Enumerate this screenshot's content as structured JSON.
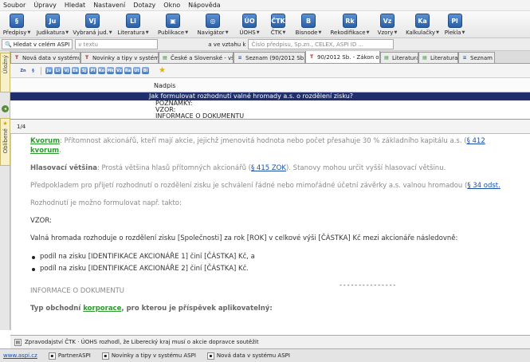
{
  "menu": [
    "Soubor",
    "Úpravy",
    "Hledat",
    "Nastavení",
    "Dotazy",
    "Okno",
    "Nápověda"
  ],
  "toolbar": [
    {
      "label": "Předpisy",
      "glyph": "§",
      "w": 42
    },
    {
      "label": "Judikatura",
      "glyph": "Ju",
      "w": 48
    },
    {
      "label": "Vybraná jud.",
      "glyph": "Vj",
      "w": 52
    },
    {
      "label": "Literatura",
      "glyph": "Li",
      "w": 50
    },
    {
      "label": "Publikace",
      "glyph": "▣",
      "w": 50
    },
    {
      "label": "Navigátor",
      "glyph": "◎",
      "w": 50
    },
    {
      "label": "ÚOHS",
      "glyph": "ÚO",
      "w": 42
    },
    {
      "label": "ČTK",
      "glyph": "ČTK",
      "w": 30
    },
    {
      "label": "Bisnode",
      "glyph": "B",
      "w": 46
    },
    {
      "label": "Rekodifikace",
      "glyph": "Rk",
      "w": 58
    },
    {
      "label": "Vzory",
      "glyph": "Vz",
      "w": 36
    },
    {
      "label": "Kalkulačky",
      "glyph": "Ka",
      "w": 52
    },
    {
      "label": "Plekla",
      "glyph": "Pl",
      "w": 29
    }
  ],
  "search": {
    "label1": "Hledat v celém ASPI",
    "placeholder1": "v textu",
    "label2": "a ve vztahu k",
    "placeholder2": "Číslo předpisu, Sp.zn., CELEX, ASPI ID ..."
  },
  "left_tabs": {
    "top": "Úložný",
    "bottom": "Oblíbené"
  },
  "doc_tabs": [
    {
      "label": "Nová data v systému A...",
      "icon": "T",
      "color": "#c02020",
      "w": 88,
      "active": false
    },
    {
      "label": "Novinky a tipy v systém...",
      "icon": "T",
      "color": "#c02020",
      "w": 98,
      "active": false
    },
    {
      "label": "České a Slovenské - vše...",
      "icon": "▤",
      "color": "#3a8a3a",
      "w": 94,
      "active": false
    },
    {
      "label": "Seznam (90/2012 Sb.)",
      "icon": "≡",
      "color": "#3a5fa0",
      "w": 90,
      "active": false
    },
    {
      "label": "90/2012 Sb. - Zákon o ...",
      "icon": "T",
      "color": "#c02020",
      "w": 94,
      "active": true
    },
    {
      "label": "Literatura",
      "icon": "▤",
      "color": "#3a8a3a",
      "w": 48,
      "active": false
    },
    {
      "label": "Literatura",
      "icon": "▤",
      "color": "#3a8a3a",
      "w": 50,
      "active": false
    },
    {
      "label": "Seznam ()",
      "icon": "≡",
      "color": "#3a5fa0",
      "w": 46,
      "active": false
    }
  ],
  "format_toolbar": [
    "Zn",
    "§",
    "Ju",
    "Li",
    "Vj",
    "Ek",
    "Sj",
    "Pl",
    "Ko",
    "Mk",
    "Vz",
    "Ra",
    "Ut",
    "Bi"
  ],
  "results": {
    "column": "Nadpis",
    "selected": "Jak formulovat rozhodnutí valné hromady a.s. o rozdělení zisku?",
    "rows": [
      "POZNÁMKY:",
      "VZOR:",
      "INFORMACE O DOKUMENTU"
    ],
    "page": "1/4"
  },
  "content": {
    "kvorum_term": "Kvorum",
    "kvorum_text": ": Přítomnost akcionářů, kteří mají akcie, jejichž jmenovitá hodnota nebo počet přesahuje 30 % základního kapitálu a.s. (",
    "kvorum_ref": "§ 412",
    "kvorum_line2": "kvorum",
    "hv_term": "Hlasovací většina",
    "hv_text": ": Prostá většina hlasů přítomných akcionářů (",
    "hv_ref": "§ 415 ZOK",
    "hv_text2": "). Stanovy mohou určit vyšší hlasovací většinu.",
    "pred_text": "Předpokladem pro přijetí rozhodnutí o rozdělení zisku je schválení řádné nebo mimořádné účetní závěrky a.s. valnou hromadou (",
    "pred_ref": "§ 34 odst.",
    "formul": "Rozhodnutí je možno formulovat např. takto:",
    "vzor": "VZOR:",
    "vh_text": "Valná hromada rozhoduje o rozdělení zisku [Společnosti] za rok [ROK] v celkové výši [ČÁSTKA] Kč mezi akcionáře následovně:",
    "bullets": [
      "podíl na zisku [IDENTIFIKACE AKCIONÁŘE 1] činí [ČÁSTKA] Kč, a",
      "podíl na zisku [IDENTIFIKACE AKCIONÁŘE 2] činí [ČÁSTKA] Kč."
    ],
    "dashes": "---------------",
    "info": "INFORMACE O DOKUMENTU",
    "typ_label": "Typ obchodní ",
    "typ_link": "korporace",
    "typ_rest": ", pro kterou je příspěvek aplikovatelný:"
  },
  "newsbar": "Zpravodajství ČTK · ÚOHS rozhodl, že Liberecký kraj musí o akcie dopravce soutěžit",
  "status": [
    "www.aspi.cz",
    "PartnerASPI",
    "Novinky a tipy v systému ASPI",
    "Nová data v systému ASPI"
  ]
}
